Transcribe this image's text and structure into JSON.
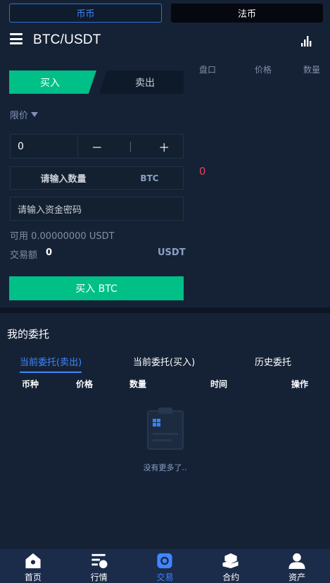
{
  "top_tabs": {
    "coin": "币币",
    "fiat": "法币"
  },
  "header": {
    "pair": "BTC/USDT"
  },
  "trade": {
    "buy_tab": "买入",
    "sell_tab": "卖出",
    "order_type": "限价",
    "price_value": "0",
    "minus": "－",
    "plus": "＋",
    "stepper_sep": "|",
    "amount_placeholder": "请输入数量",
    "amount_unit": "BTC",
    "password_placeholder": "请输入资金密码",
    "available": "可用 0.00000000  USDT",
    "turnover_label": "交易额",
    "turnover_value": "0",
    "turnover_unit": "USDT",
    "submit_button": "买入 BTC"
  },
  "order_book": {
    "headers": [
      "盘口",
      "价格",
      "数量"
    ],
    "price": "0",
    "price_color": "#e0415a"
  },
  "orders": {
    "title": "我的委托",
    "tabs": [
      "当前委托(卖出)",
      "当前委托(买入)",
      "历史委托"
    ],
    "columns": [
      "币种",
      "价格",
      "数量",
      "时间",
      "操作"
    ],
    "empty_text": "没有更多了.."
  },
  "tabbar": {
    "items": [
      {
        "label": "首页",
        "icon": "home-icon"
      },
      {
        "label": "行情",
        "icon": "market-icon"
      },
      {
        "label": "交易",
        "icon": "trade-icon"
      },
      {
        "label": "合约",
        "icon": "contract-icon"
      },
      {
        "label": "资产",
        "icon": "assets-icon"
      }
    ],
    "active_index": 2
  },
  "colors": {
    "accent_green": "#00c087",
    "accent_blue": "#3f86ff",
    "background": "#152236"
  }
}
